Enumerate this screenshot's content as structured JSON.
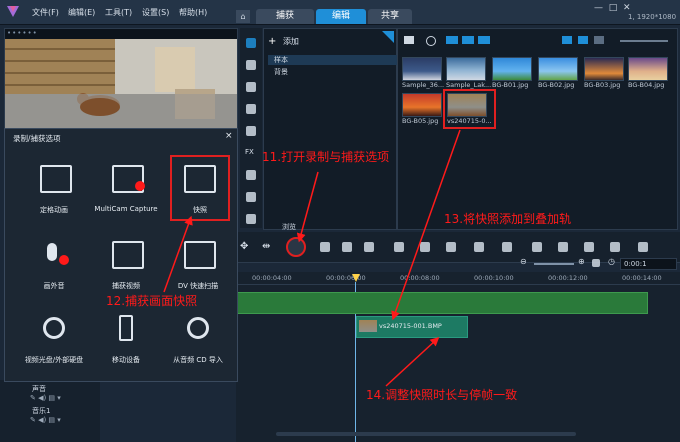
{
  "titlebar": {
    "resolution": "1, 1920*1080",
    "menu": [
      "文件(F)",
      "编辑(E)",
      "工具(T)",
      "设置(S)",
      "帮助(H)"
    ],
    "tabs": [
      "捕获",
      "编辑",
      "共享"
    ],
    "active_tab": "编辑"
  },
  "library": {
    "add_label": "添加",
    "folders": [
      "样本",
      "背景"
    ],
    "browse_label": "浏览",
    "thumbnails": [
      "Sample_36...",
      "Sample_Lak...",
      "BG-B01.jpg",
      "BG-B02.jpg",
      "BG-B03.jpg",
      "BG-B04.jpg",
      "BG-B05.jpg",
      "vs240715-0..."
    ]
  },
  "dialog": {
    "title": "录制/捕获选项",
    "options": [
      "定格动画",
      "MultiCam Capture",
      "快照",
      "画外音",
      "捕获视频",
      "DV 快速扫描",
      "视频光盘/外部硬盘",
      "移动设备",
      "从音频 CD 导入"
    ]
  },
  "timeline": {
    "ticks": [
      "00:00:04:00",
      "00:00:06:00",
      "00:00:08:00",
      "00:00:10:00",
      "00:00:12:00",
      "00:00:14:00"
    ],
    "timecode": "0:00:1",
    "clip_label": "vs240715-001.BMP",
    "tracks": [
      "声音",
      "音乐1"
    ]
  },
  "annotations": [
    "11.打开录制与捕获选项",
    "12.捕获画面快照",
    "13.将快照添加到叠加轨",
    "14.调整快照时长与停帧一致"
  ],
  "colors": {
    "accent": "#1f8fd8",
    "annotation": "#ff1a1a",
    "clip": "#1d7a63"
  }
}
